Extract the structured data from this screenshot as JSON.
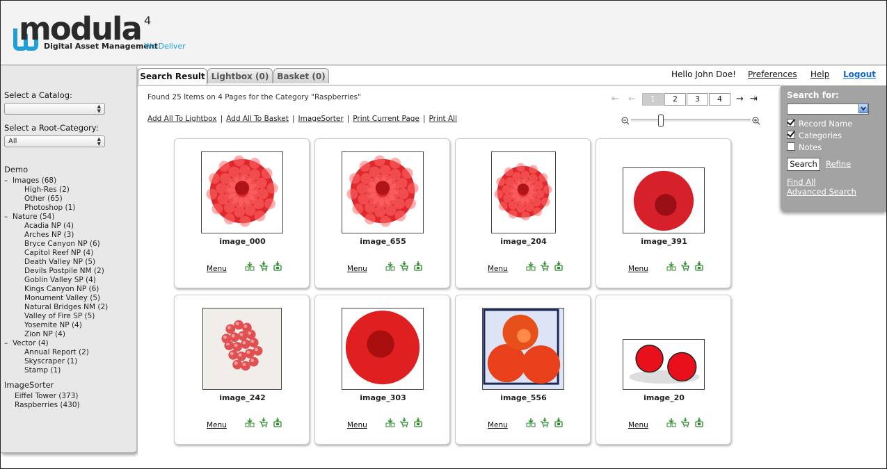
{
  "brand": {
    "name": "modula",
    "superscript": "4",
    "tagline": "Digital Asset Management",
    "tagline_accent": "We Deliver",
    "accent_color": "#1e9fd8"
  },
  "sidebar": {
    "catalog_label": "Select a Catalog:",
    "catalog_value": "",
    "root_label": "Select a Root-Category:",
    "root_value": "All",
    "sections": [
      {
        "title": "Demo",
        "groups": [
          {
            "label": "Images (68)",
            "items": [
              "High-Res (2)",
              "Other (65)",
              "Photoshop (1)"
            ]
          },
          {
            "label": "Nature (54)",
            "items": [
              "Acadia NP (4)",
              "Arches NP (3)",
              "Bryce Canyon NP (6)",
              "Capitol Reef NP (4)",
              "Death Valley NP (5)",
              "Devils Postpile NM (2)",
              "Goblin Valley SP (4)",
              "Kings Canyon NP (6)",
              "Monument Valley (5)",
              "Natural Bridges NM (2)",
              "Valley of Fire SP (5)",
              "Yosemite NP (4)",
              "Zion NP (4)"
            ]
          },
          {
            "label": "Vector (4)",
            "items": [
              "Annual Report (2)",
              "Skyscraper (1)",
              "Stamp (1)"
            ]
          }
        ]
      }
    ],
    "imagesorter": {
      "title": "ImageSorter",
      "items": [
        "Eiffel Tower (373)",
        "Raspberries (430)"
      ]
    }
  },
  "tabs": [
    "Search Result",
    "Lightbox (0)",
    "Basket (0)"
  ],
  "topnav": {
    "greeting": "Hello John Doe!",
    "preferences": "Preferences",
    "help": "Help",
    "logout": "Logout"
  },
  "results": {
    "found_text": "Found 25 Items on 4 Pages for the Category \"Raspberries\"",
    "actions": [
      "Add All To Lightbox",
      "Add All To Basket",
      "ImageSorter",
      "Print Current Page",
      "Print All"
    ],
    "pages": [
      "1",
      "2",
      "3",
      "4"
    ],
    "current_page": "1",
    "zoom_level": 0.25,
    "menu_label": "Menu",
    "items": [
      {
        "name": "image_000"
      },
      {
        "name": "image_655"
      },
      {
        "name": "image_204"
      },
      {
        "name": "image_391"
      },
      {
        "name": "image_242"
      },
      {
        "name": "image_303"
      },
      {
        "name": "image_556"
      },
      {
        "name": "image_20"
      }
    ]
  },
  "search": {
    "title": "Search for:",
    "value": "",
    "options": [
      {
        "label": "Record Name",
        "checked": true
      },
      {
        "label": "Categories",
        "checked": true
      },
      {
        "label": "Notes",
        "checked": false
      }
    ],
    "search_button": "Search",
    "refine": "Refine",
    "find_all": "Find All",
    "advanced": "Advanced Search"
  }
}
